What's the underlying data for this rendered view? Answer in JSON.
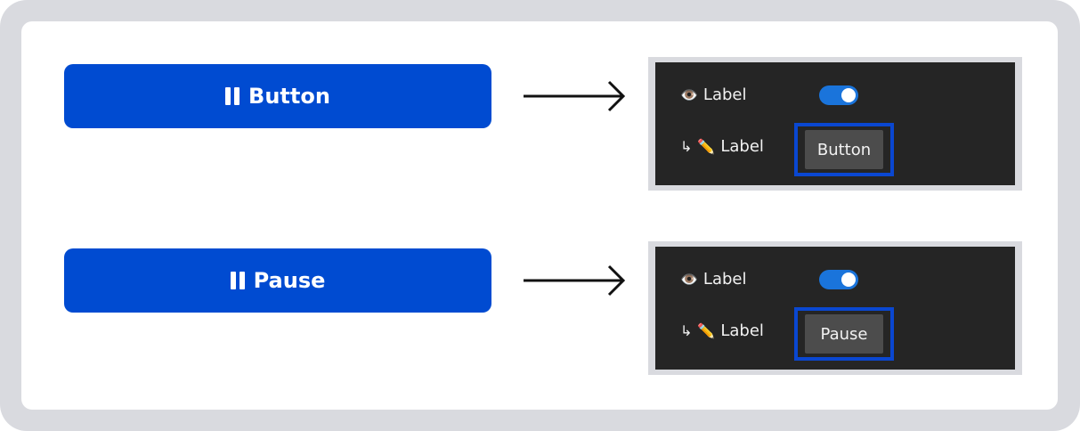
{
  "rows": [
    {
      "button_label": "Button",
      "label_1": "Label",
      "label_2": "Label",
      "eye_glyph": "👁️",
      "arrow_glyph": "↳",
      "pencil_glyph": "✏️",
      "small_button_label": "Button",
      "toggle_on": true
    },
    {
      "button_label": "Pause",
      "label_1": "Label",
      "label_2": "Label",
      "eye_glyph": "👁️",
      "arrow_glyph": "↳",
      "pencil_glyph": "✏️",
      "small_button_label": "Pause",
      "toggle_on": true
    }
  ],
  "colors": {
    "primary_button": "#004bd1",
    "highlight_border": "#0a47d1",
    "toggle_on": "#1a74db",
    "panel_dark": "#252525",
    "frame": "#d9dadf"
  },
  "icons": {
    "primary_button_icon": "pause-icon",
    "connector": "right-arrow-icon",
    "label_1_icon": "eye-icon",
    "label_2_icon": "pencil-icon"
  }
}
